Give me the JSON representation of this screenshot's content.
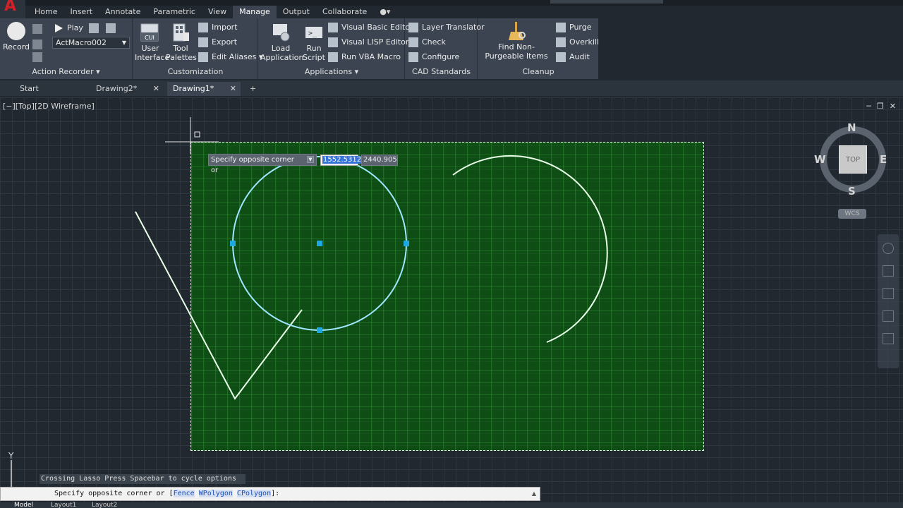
{
  "menu": {
    "tabs": [
      "Home",
      "Insert",
      "Annotate",
      "Parametric",
      "View",
      "Manage",
      "Output",
      "Collaborate"
    ],
    "active": "Manage"
  },
  "ribbon": {
    "action_recorder": {
      "title": "Action Recorder",
      "record": "Record",
      "play": "Play",
      "macro": "ActMacro002"
    },
    "customization": {
      "title": "Customization",
      "user_interface": "User Interface",
      "tool_palettes": "Tool Palettes",
      "import": "Import",
      "export": "Export",
      "edit_aliases": "Edit Aliases",
      "cui_badge": "CUI"
    },
    "applications": {
      "title": "Applications",
      "load_application": "Load Application",
      "run_script": "Run Script",
      "vba_editor": "Visual Basic Editor",
      "lisp_editor": "Visual LISP Editor",
      "run_vba": "Run VBA Macro"
    },
    "cad_standards": {
      "title": "CAD Standards",
      "layer_translator": "Layer Translator",
      "check": "Check",
      "configure": "Configure"
    },
    "cleanup": {
      "title": "Cleanup",
      "find_nonpurgeable": "Find Non-Purgeable Items",
      "purge": "Purge",
      "overkill": "Overkill",
      "audit": "Audit"
    }
  },
  "file_tabs": [
    {
      "label": "Start"
    },
    {
      "label": "Drawing2*"
    },
    {
      "label": "Drawing1*"
    }
  ],
  "viewport": {
    "label": "[−][Top][2D Wireframe]"
  },
  "dynamic_input": {
    "prompt": "Specify opposite corner or",
    "x_value": "1552.5312",
    "y_value": "2440.905"
  },
  "viewcube": {
    "n": "N",
    "s": "S",
    "e": "E",
    "w": "W",
    "face": "TOP",
    "wcs": "WCS"
  },
  "ucs": {
    "y": "Y"
  },
  "command": {
    "history": "Crossing Lasso  Press Spacebar to cycle options",
    "prompt_prefix": "Specify opposite corner or [",
    "opt_fence": "Fence",
    "opt_wpolygon": "WPolygon",
    "opt_cpolygon": "CPolygon",
    "prompt_suffix": "]:"
  },
  "status_tabs": [
    "Model",
    "Layout1",
    "Layout2"
  ],
  "colors": {
    "accent_red": "#d42027",
    "selection_green": "#006e00",
    "grip_blue": "#1ea7e0",
    "circle_selected": "#9fe6ff",
    "entity_white": "#e8ffe8"
  }
}
